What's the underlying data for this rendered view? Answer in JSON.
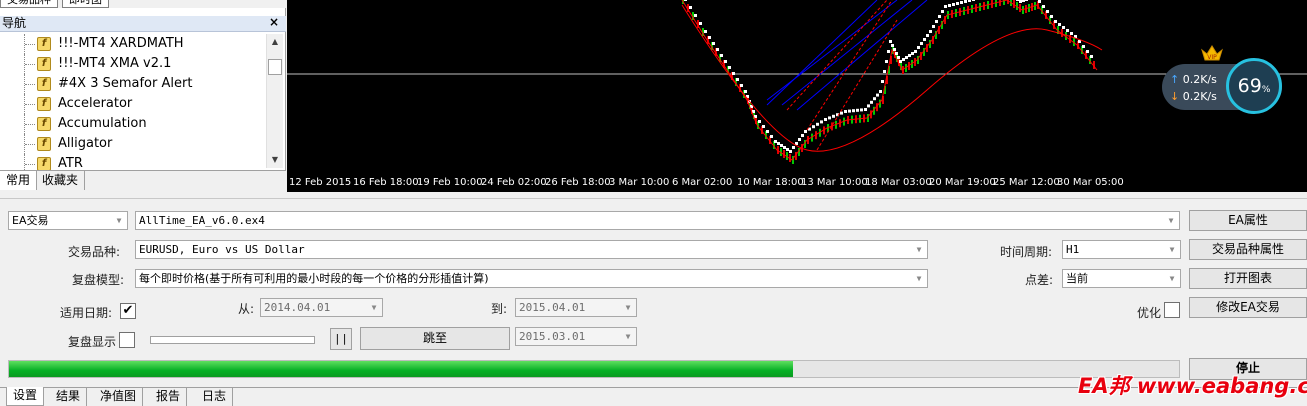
{
  "navigator": {
    "top_tabs": [
      "交易品种",
      "即时图"
    ],
    "title": "导航",
    "close_glyph": "×",
    "items": [
      {
        "label": "!!!-MT4 XARDMATH"
      },
      {
        "label": "!!!-MT4 XMA v2.1"
      },
      {
        "label": "#4X 3 Semafor Alert"
      },
      {
        "label": "Accelerator"
      },
      {
        "label": "Accumulation"
      },
      {
        "label": "Alligator"
      },
      {
        "label": "ATR"
      }
    ],
    "icon": "indicator-f-icon",
    "bottom_tabs": [
      "常用",
      "收藏夹"
    ]
  },
  "chart": {
    "x_ticks": [
      "12 Feb 2015",
      "16 Feb 18:00",
      "19 Feb 10:00",
      "24 Feb 02:00",
      "26 Feb 18:00",
      "3 Mar 10:00",
      "6 Mar 02:00",
      "10 Mar 18:00",
      "13 Mar 10:00",
      "18 Mar 03:00",
      "20 Mar 19:00",
      "25 Mar 12:00",
      "30 Mar 05:00"
    ],
    "colors": {
      "background": "#000000",
      "up": "#00c800",
      "down": "#e00000",
      "ma1": "#ff0000",
      "ma2": "#0000ff",
      "hline": "#c0c0c0"
    }
  },
  "speed_widget": {
    "upload": "0.2K/s",
    "download": "0.2K/s",
    "percent": "69",
    "percent_sign": "%",
    "crown_badge": "VIP"
  },
  "tester": {
    "mode": "EA交易",
    "expert": "AllTime_EA_v6.0.ex4",
    "expert_props_button": "EA属性",
    "symbol_label": "交易品种:",
    "symbol": "EURUSD, Euro vs US Dollar",
    "period_label": "时间周期:",
    "period": "H1",
    "symbol_props_button": "交易品种属性",
    "model_label": "复盘模型:",
    "model": "每个即时价格(基于所有可利用的最小时段的每一个价格的分形插值计算)",
    "spread_label": "点差:",
    "spread": "当前",
    "open_chart_button": "打开图表",
    "use_date_label": "适用日期:",
    "use_date_checked": "✔",
    "from_label": "从:",
    "from_date": "2014.04.01",
    "to_label": "到:",
    "to_date": "2015.04.01",
    "optimize_label": "优化",
    "modify_expert_button": "修改EA交易",
    "visual_label": "复盘显示",
    "pause_glyph": "| |",
    "skip_to_button": "跳至",
    "skip_date": "2015.03.01",
    "progress": 0.67,
    "stop_button": "停止",
    "tabs": [
      "设置",
      "结果",
      "净值图",
      "报告",
      "日志"
    ]
  },
  "watermark": "EA邦 www.eabang.com"
}
